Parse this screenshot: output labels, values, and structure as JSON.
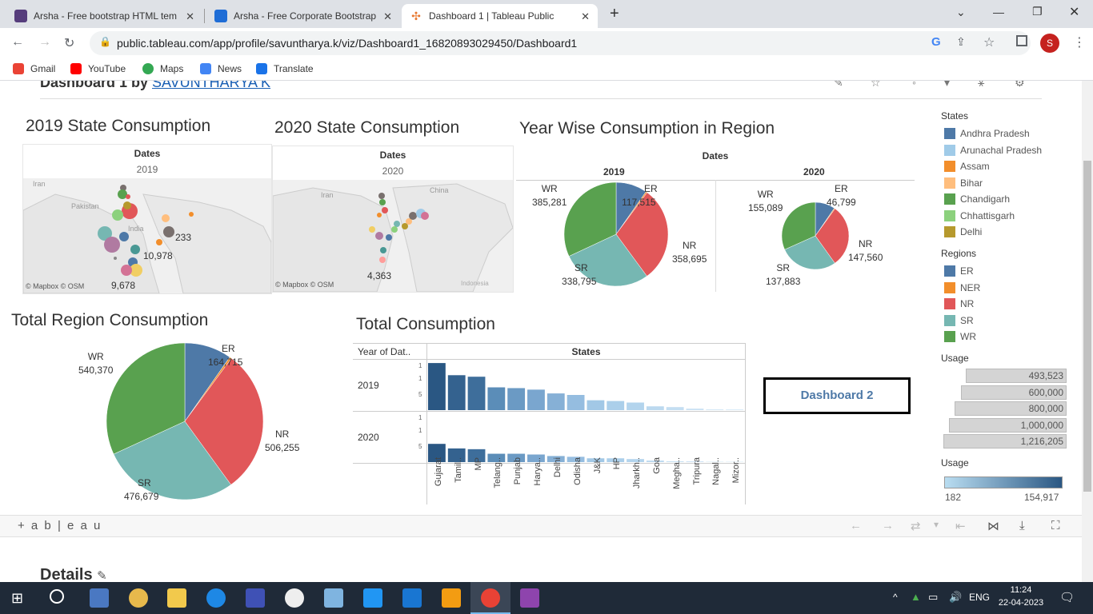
{
  "browser": {
    "tabs": [
      {
        "label": "Arsha - Free bootstrap HTML tem",
        "icon": "bootstrap-icon"
      },
      {
        "label": "Arsha - Free Corporate Bootstrap",
        "icon": "template-icon"
      },
      {
        "label": "Dashboard 1 | Tableau Public",
        "icon": "tableau-icon"
      }
    ],
    "url": "public.tableau.com/app/profile/savuntharya.k/viz/Dashboard1_16820893029450/Dashboard1",
    "profile_initial": "S",
    "bookmarks": [
      "Gmail",
      "YouTube",
      "Maps",
      "News",
      "Translate"
    ]
  },
  "header": {
    "title": "Dashboard 1 by",
    "author": "SAVUNTHARYA K"
  },
  "maps": [
    {
      "title": "2019 State Consumption",
      "header": "Dates",
      "year": "2019",
      "labels": [
        "233",
        "10,978",
        "9,678"
      ],
      "credit": "© Mapbox © OSM",
      "places": [
        "Iran",
        "Pakistan",
        "India"
      ]
    },
    {
      "title": "2020 State Consumption",
      "header": "Dates",
      "year": "2020",
      "labels": [
        "4,363"
      ],
      "credit": "© Mapbox © OSM",
      "places": [
        "Iran",
        "China",
        "Indonesia"
      ]
    }
  ],
  "region_pies": {
    "title": "Year Wise Consumption in Region",
    "header": "Dates",
    "years": [
      {
        "year": "2019",
        "WR": "385,281",
        "ER": "117,515",
        "NR": "358,695",
        "SR": "338,795"
      },
      {
        "year": "2020",
        "WR": "155,089",
        "ER": "46,799",
        "NR": "147,560",
        "SR": "137,883"
      }
    ]
  },
  "total_region": {
    "title": "Total Region Consumption",
    "WR": "540,370",
    "ER": "164,715",
    "NR": "506,255",
    "SR": "476,679"
  },
  "total_consumption": {
    "title": "Total Consumption",
    "row_header": "Year of Dat..",
    "col_header": "States",
    "rows": [
      "2019",
      "2020"
    ],
    "axis_ticks": [
      "1",
      "1",
      "5"
    ],
    "states": [
      "Gujarat",
      "Tamil..",
      "MP",
      "Telang..",
      "Punjab",
      "Harya..",
      "Delhi",
      "Odisha",
      "J&K",
      "HP",
      "Jharkh..",
      "Goa",
      "Megha..",
      "Tripura",
      "Nagal..",
      "Mizor.."
    ]
  },
  "button": {
    "label": "Dashboard 2"
  },
  "legend": {
    "states_title": "States",
    "states": [
      {
        "name": "Andhra Pradesh",
        "color": "#4e79a7"
      },
      {
        "name": "Arunachal Pradesh",
        "color": "#a0cbe8"
      },
      {
        "name": "Assam",
        "color": "#f28e2b"
      },
      {
        "name": "Bihar",
        "color": "#ffbe7d"
      },
      {
        "name": "Chandigarh",
        "color": "#59a14f"
      },
      {
        "name": "Chhattisgarh",
        "color": "#8cd17d"
      },
      {
        "name": "Delhi",
        "color": "#b6992d"
      }
    ],
    "regions_title": "Regions",
    "regions": [
      {
        "name": "ER",
        "color": "#4e79a7"
      },
      {
        "name": "NER",
        "color": "#f28e2b"
      },
      {
        "name": "NR",
        "color": "#e15759"
      },
      {
        "name": "SR",
        "color": "#76b7b2"
      },
      {
        "name": "WR",
        "color": "#59a14f"
      }
    ],
    "usage_title": "Usage",
    "usage_sizes": [
      "493,523",
      "600,000",
      "800,000",
      "1,000,000",
      "1,216,205"
    ],
    "usage2_title": "Usage",
    "usage_min": "182",
    "usage_max": "154,917"
  },
  "footer": {
    "brand": "+ a b | e a u",
    "details": "Details"
  },
  "taskbar": {
    "lang": "ENG",
    "time": "11:24",
    "date": "22-04-2023"
  },
  "chart_data": [
    {
      "type": "pie",
      "title": "Year Wise Consumption in Region (2019)",
      "categories": [
        "ER",
        "NER",
        "NR",
        "SR",
        "WR"
      ],
      "values": [
        117515,
        5000,
        358695,
        338795,
        385281
      ]
    },
    {
      "type": "pie",
      "title": "Year Wise Consumption in Region (2020)",
      "categories": [
        "ER",
        "NER",
        "NR",
        "SR",
        "WR"
      ],
      "values": [
        46799,
        2000,
        147560,
        137883,
        155089
      ]
    },
    {
      "type": "pie",
      "title": "Total Region Consumption",
      "categories": [
        "ER",
        "NER",
        "NR",
        "SR",
        "WR"
      ],
      "values": [
        164715,
        7000,
        506255,
        476679,
        540370
      ]
    },
    {
      "type": "bar",
      "title": "Total Consumption",
      "categories": [
        "Gujarat",
        "Tamil..",
        "MP",
        "Telang..",
        "Punjab",
        "Harya..",
        "Delhi",
        "Odisha",
        "J&K",
        "HP",
        "Jharkh..",
        "Goa",
        "Megha..",
        "Tripura",
        "Nagal..",
        "Mizor.."
      ],
      "series": [
        {
          "name": "2019",
          "values": [
            62,
            46,
            44,
            30,
            29,
            27,
            22,
            20,
            13,
            12,
            10,
            5,
            4,
            2,
            1,
            1
          ]
        },
        {
          "name": "2020",
          "values": [
            24,
            18,
            17,
            11,
            11,
            10,
            8,
            7,
            5,
            5,
            4,
            2,
            1,
            1,
            0.5,
            0.5
          ]
        }
      ]
    }
  ]
}
